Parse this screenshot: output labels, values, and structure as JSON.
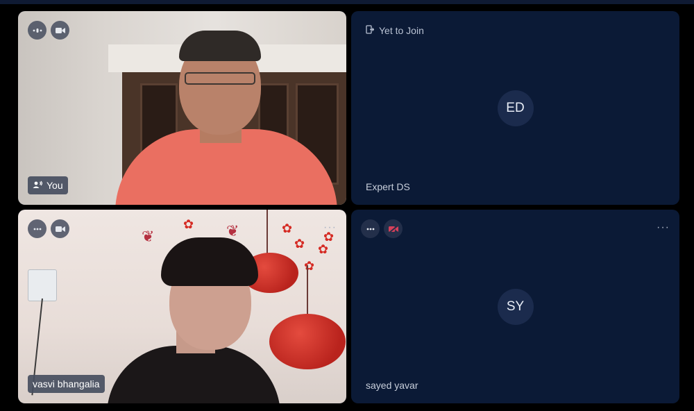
{
  "participants": [
    {
      "name": "You",
      "speaking": true
    },
    {
      "initials": "ED",
      "name": "Expert DS",
      "status": "Yet to Join"
    },
    {
      "name": "vasvi bhangalia"
    },
    {
      "initials": "SY",
      "name": "sayed yavar",
      "video_muted": true
    }
  ],
  "icons": {
    "more": "more-horizontal-icon",
    "camera": "video-camera-icon",
    "camera_off": "video-camera-off-icon",
    "audio_level": "audio-level-icon",
    "speaker": "speaker-icon",
    "exit": "exit-icon"
  },
  "colors": {
    "background": "#000000",
    "tile": "#0b1a36",
    "camera_off_accent": "#d6405a"
  }
}
